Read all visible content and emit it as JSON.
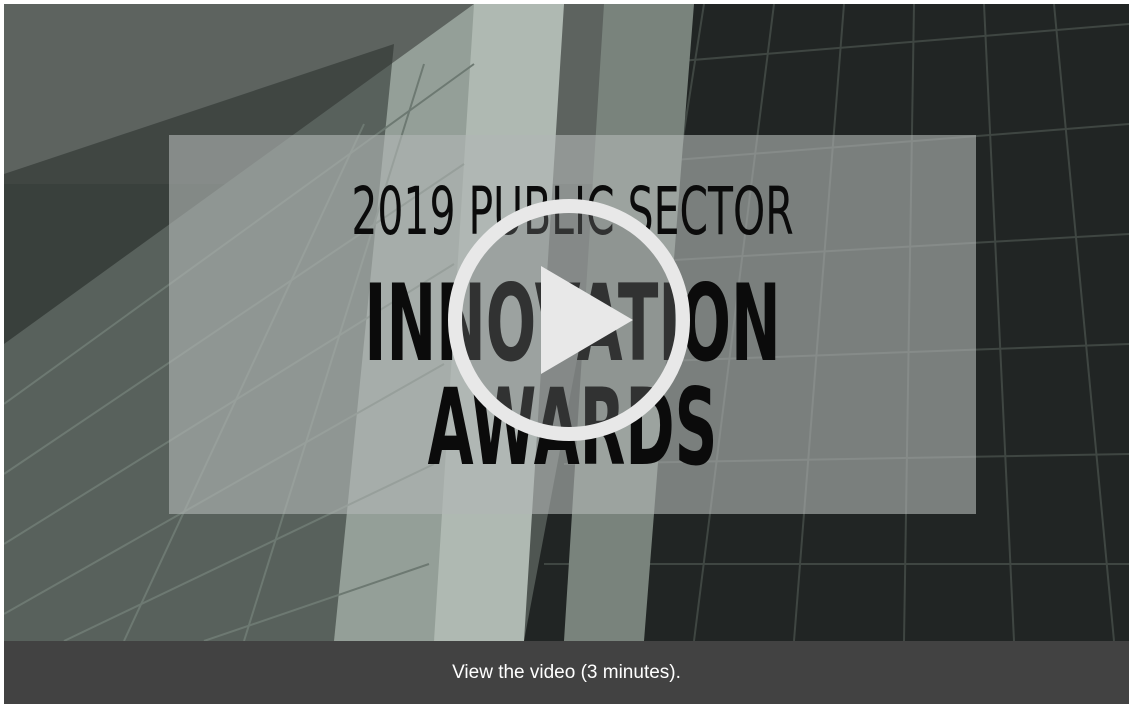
{
  "video": {
    "title_line_1": "2019 PUBLIC SECTOR",
    "title_line_2": "INNOVATION",
    "title_line_3": "AWARDS",
    "play_icon": "play-circle-icon"
  },
  "caption": {
    "text": "View the video (3 minutes)."
  },
  "colors": {
    "caption_background": "#424242",
    "caption_text": "#ffffff",
    "title_text": "#0b0b0b",
    "play_button": "#e8e8e8"
  }
}
